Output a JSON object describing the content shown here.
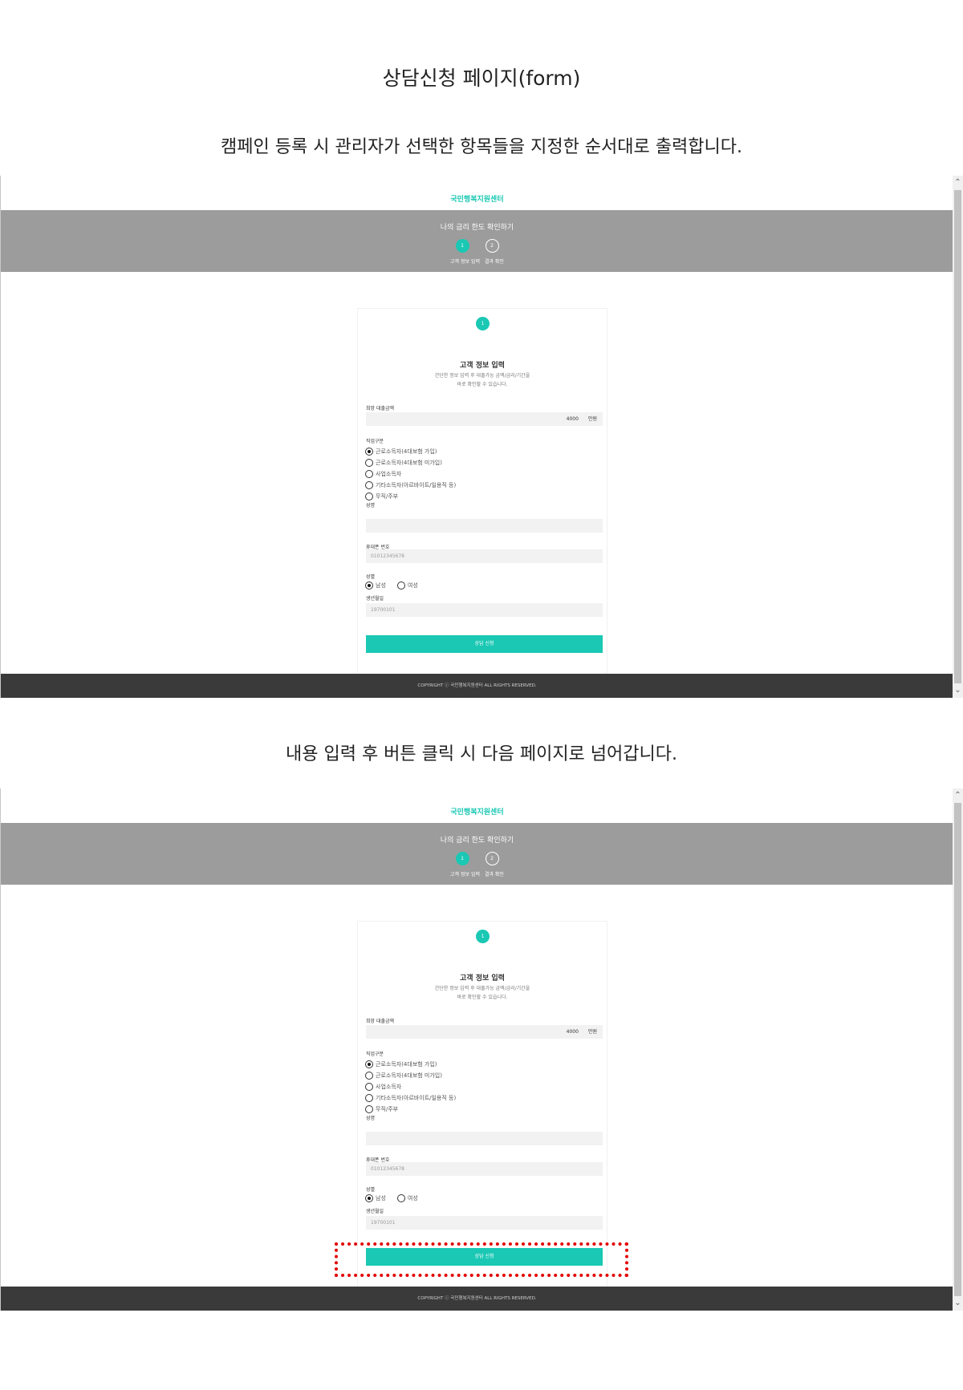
{
  "document": {
    "title": "상담신청 페이지(form)",
    "caption_1": "캠페인 등록 시 관리자가 선택한 항목들을 지정한 순서대로 출력합니다.",
    "caption_2": "내용 입력 후 버튼 클릭 시 다음 페이지로 넘어갑니다."
  },
  "site": {
    "logo": "국민행복지원센터",
    "hero_title": "나의 금리 한도 확인하기",
    "steps": [
      {
        "number": "1",
        "label": "고객 정보 입력",
        "active": true
      },
      {
        "number": "2",
        "label": "결과 확인",
        "active": false
      }
    ],
    "footer": "COPYRIGHT ⓒ 국민행복지원센터 ALL RIGHTS RESERVED."
  },
  "form": {
    "step_number": "1",
    "title": "고객 정보 입력",
    "description_line1": "간단한 정보 입력 후 대출가능 금액/금리/기간을",
    "description_line2": "바로 확인할 수 있습니다.",
    "loan_amount": {
      "label": "희망 대출금액",
      "value": "4000",
      "unit": "만원"
    },
    "job": {
      "label": "직업구분",
      "options": [
        {
          "label": "근로소득자(4대보험 가입)",
          "checked": true
        },
        {
          "label": "근로소득자(4대보험 미가입)",
          "checked": false
        },
        {
          "label": "사업소득자",
          "checked": false
        },
        {
          "label": "기타소득자(아르바이트/일용직 등)",
          "checked": false
        },
        {
          "label": "무직/주부",
          "checked": false
        }
      ]
    },
    "name": {
      "label": "성명",
      "value": ""
    },
    "phone": {
      "label": "휴대폰 번호",
      "placeholder": "01012345678"
    },
    "gender": {
      "label": "성별",
      "options": [
        {
          "label": "남성",
          "checked": true
        },
        {
          "label": "여성",
          "checked": false
        }
      ]
    },
    "birth": {
      "label": "생년월일",
      "placeholder": "19700101"
    },
    "submit_label": "상담 신청"
  },
  "highlight_color": "#e30000",
  "accent_color": "#1ac8b4"
}
